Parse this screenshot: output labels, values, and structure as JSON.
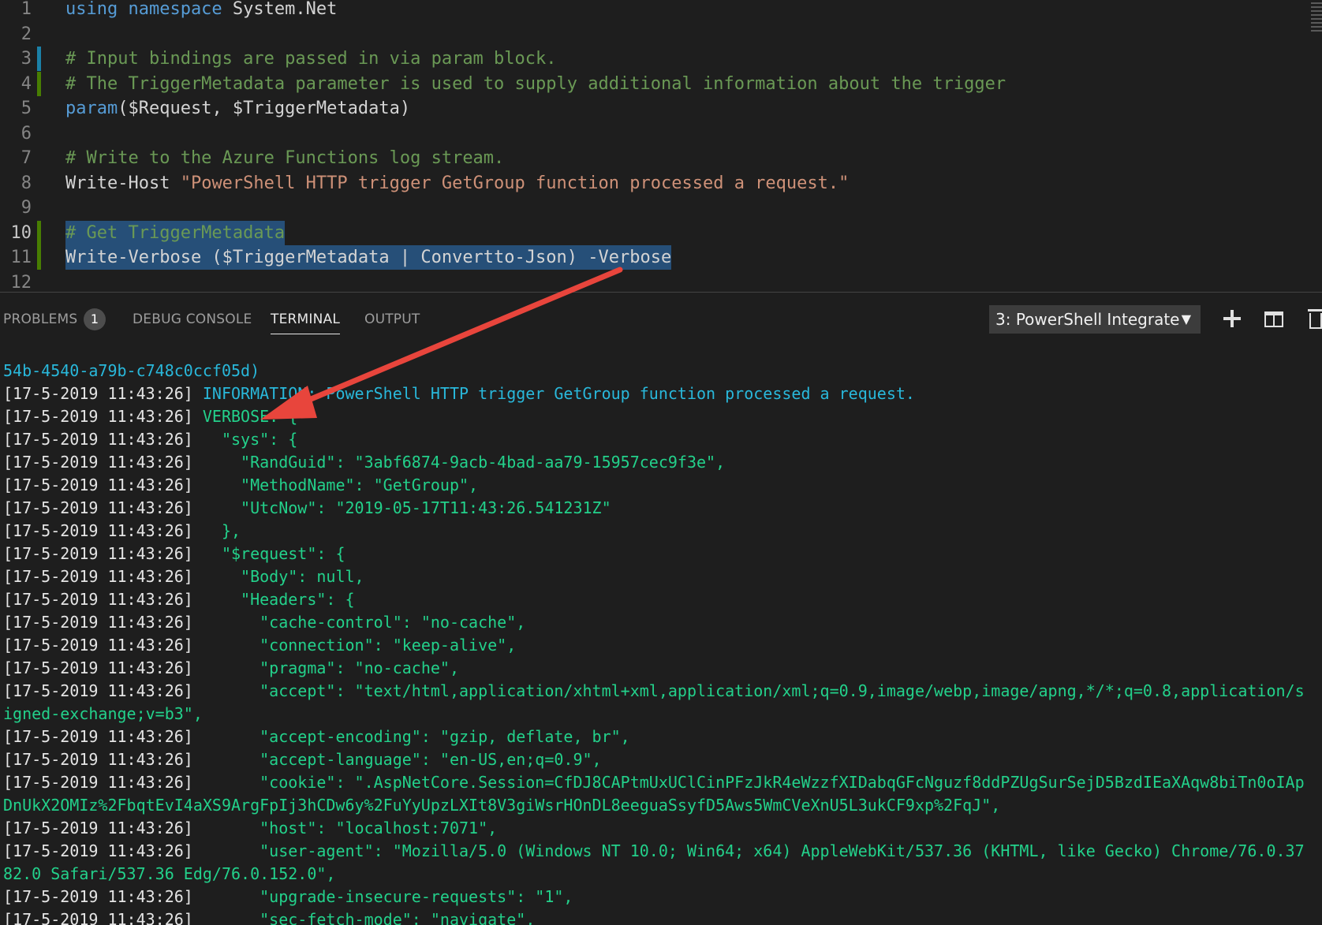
{
  "editor": {
    "lines": [
      {
        "n": "1",
        "parts": [
          [
            "kw",
            "using namespace "
          ],
          [
            "plain",
            "System.Net"
          ]
        ]
      },
      {
        "n": "2",
        "parts": []
      },
      {
        "n": "3",
        "parts": [
          [
            "cm",
            "# Input bindings are passed in via param block."
          ]
        ]
      },
      {
        "n": "4",
        "parts": [
          [
            "cm",
            "# The TriggerMetadata parameter is used to supply additional information about the trigger"
          ]
        ]
      },
      {
        "n": "5",
        "parts": [
          [
            "kw",
            "param"
          ],
          [
            "plain",
            "($Request, $TriggerMetadata)"
          ]
        ]
      },
      {
        "n": "6",
        "parts": []
      },
      {
        "n": "7",
        "parts": [
          [
            "cm",
            "# Write to the Azure Functions log stream."
          ]
        ]
      },
      {
        "n": "8",
        "parts": [
          [
            "plain",
            "Write-Host "
          ],
          [
            "str",
            "\"PowerShell HTTP trigger GetGroup function processed a request.\""
          ]
        ]
      },
      {
        "n": "9",
        "parts": []
      },
      {
        "n": "10",
        "active": true,
        "selected": true,
        "parts": [
          [
            "cm",
            "# Get TriggerMetadata"
          ]
        ]
      },
      {
        "n": "11",
        "selected": true,
        "parts": [
          [
            "plain",
            "Write-Verbose ($TriggerMetadata | Convertto-Json) -Verbose"
          ]
        ]
      },
      {
        "n": "12",
        "parts": []
      }
    ]
  },
  "panel": {
    "tabs": {
      "problems": "PROBLEMS",
      "problems_count": "1",
      "debug_console": "DEBUG CONSOLE",
      "terminal": "TERMINAL",
      "output": "OUTPUT"
    },
    "terminal_select": "3: PowerShell Integrate"
  },
  "terminal": {
    "lines": [
      {
        "c": "cyan",
        "t": "54b-4540-a79b-c748c0ccf05d)"
      },
      {
        "c": "cyan",
        "ts": "[17-5-2019 11:43:26] ",
        "t": "INFORMATION: PowerShell HTTP trigger GetGroup function processed a request."
      },
      {
        "c": "green",
        "ts": "[17-5-2019 11:43:26] ",
        "t": "VERBOSE: {"
      },
      {
        "c": "green",
        "ts": "[17-5-2019 11:43:26] ",
        "t": "  \"sys\": {"
      },
      {
        "c": "green",
        "ts": "[17-5-2019 11:43:26] ",
        "t": "    \"RandGuid\": \"3abf6874-9acb-4bad-aa79-15957cec9f3e\","
      },
      {
        "c": "green",
        "ts": "[17-5-2019 11:43:26] ",
        "t": "    \"MethodName\": \"GetGroup\","
      },
      {
        "c": "green",
        "ts": "[17-5-2019 11:43:26] ",
        "t": "    \"UtcNow\": \"2019-05-17T11:43:26.541231Z\""
      },
      {
        "c": "green",
        "ts": "[17-5-2019 11:43:26] ",
        "t": "  },"
      },
      {
        "c": "green",
        "ts": "[17-5-2019 11:43:26] ",
        "t": "  \"$request\": {"
      },
      {
        "c": "green",
        "ts": "[17-5-2019 11:43:26] ",
        "t": "    \"Body\": null,"
      },
      {
        "c": "green",
        "ts": "[17-5-2019 11:43:26] ",
        "t": "    \"Headers\": {"
      },
      {
        "c": "green",
        "ts": "[17-5-2019 11:43:26] ",
        "t": "      \"cache-control\": \"no-cache\","
      },
      {
        "c": "green",
        "ts": "[17-5-2019 11:43:26] ",
        "t": "      \"connection\": \"keep-alive\","
      },
      {
        "c": "green",
        "ts": "[17-5-2019 11:43:26] ",
        "t": "      \"pragma\": \"no-cache\","
      },
      {
        "c": "green",
        "ts": "[17-5-2019 11:43:26] ",
        "t": "      \"accept\": \"text/html,application/xhtml+xml,application/xml;q=0.9,image/webp,image/apng,*/*;q=0.8,application/s"
      },
      {
        "c": "green",
        "t": "igned-exchange;v=b3\","
      },
      {
        "c": "green",
        "ts": "[17-5-2019 11:43:26] ",
        "t": "      \"accept-encoding\": \"gzip, deflate, br\","
      },
      {
        "c": "green",
        "ts": "[17-5-2019 11:43:26] ",
        "t": "      \"accept-language\": \"en-US,en;q=0.9\","
      },
      {
        "c": "green",
        "ts": "[17-5-2019 11:43:26] ",
        "t": "      \"cookie\": \".AspNetCore.Session=CfDJ8CAPtmUxUClCinPFzJkR4eWzzfXIDabqGFcNguzf8ddPZUgSurSejD5BzdIEaXAqw8biTn0oIAp"
      },
      {
        "c": "green",
        "t": "DnUkX2OMIz%2FbqtEvI4aXS9ArgFpIj3hCDw6y%2FuYyUpzLXIt8V3giWsrHOnDL8eeguaSsyfD5Aws5WmCVeXnU5L3ukCF9xp%2FqJ\","
      },
      {
        "c": "green",
        "ts": "[17-5-2019 11:43:26] ",
        "t": "      \"host\": \"localhost:7071\","
      },
      {
        "c": "green",
        "ts": "[17-5-2019 11:43:26] ",
        "t": "      \"user-agent\": \"Mozilla/5.0 (Windows NT 10.0; Win64; x64) AppleWebKit/537.36 (KHTML, like Gecko) Chrome/76.0.37"
      },
      {
        "c": "green",
        "t": "82.0 Safari/537.36 Edg/76.0.152.0\","
      },
      {
        "c": "green",
        "ts": "[17-5-2019 11:43:26] ",
        "t": "      \"upgrade-insecure-requests\": \"1\","
      },
      {
        "c": "green",
        "ts": "[17-5-2019 11:43:26] ",
        "t": "      \"sec-fetch-mode\": \"navigate\","
      }
    ]
  },
  "colors": {
    "arrow": "#e8453c",
    "gutter_modified": "#1b81a8",
    "gutter_added": "#487e02"
  }
}
